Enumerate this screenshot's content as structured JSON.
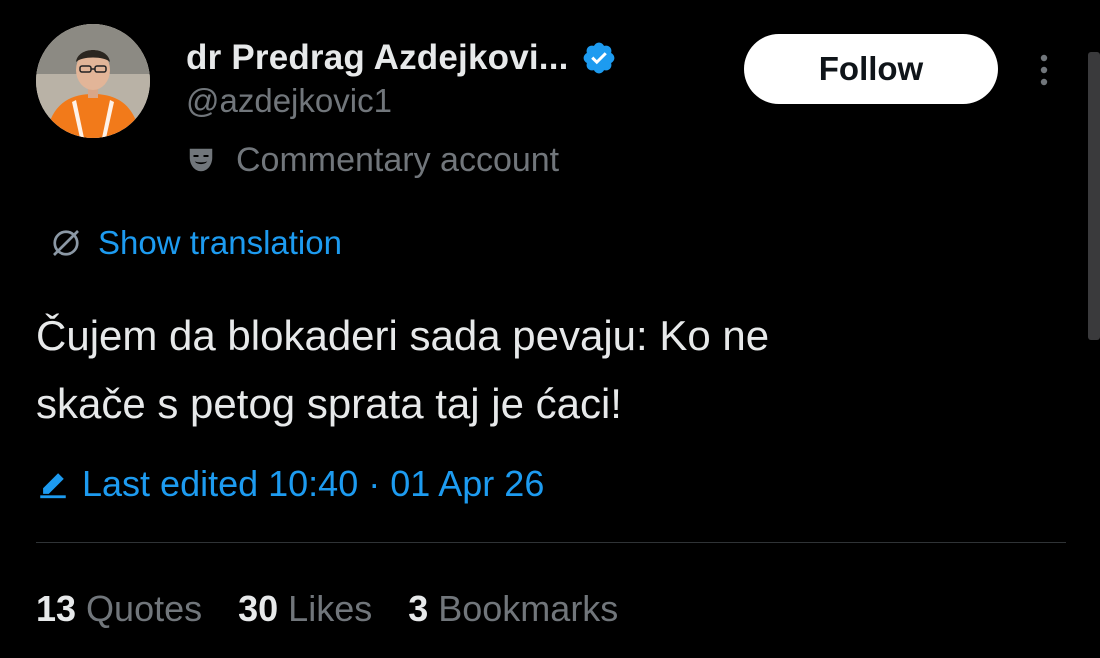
{
  "author": {
    "display_name": "dr Predrag Azdejkovi...",
    "handle": "@azdejkovic1",
    "label": "Commentary account",
    "verified_color": "#1d9bf0"
  },
  "actions": {
    "follow_label": "Follow"
  },
  "tweet": {
    "translate_label": "Show translation",
    "text": "Čujem da blokaderi sada pevaju: Ko ne\nskače s petog sprata taj je ćaci!",
    "edited_label": "Last edited 10:40 · 01 Apr 26"
  },
  "stats": [
    {
      "count": "13",
      "label": "Quotes"
    },
    {
      "count": "30",
      "label": "Likes"
    },
    {
      "count": "3",
      "label": "Bookmarks"
    }
  ],
  "icons": {
    "verified": "verified-badge-icon",
    "mask": "theater-mask-icon",
    "globe": "globe-icon",
    "pencil": "pencil-icon",
    "more": "more-vertical-icon"
  },
  "colors": {
    "background": "#000000",
    "text_primary": "#e7e9ea",
    "text_secondary": "#71767b",
    "accent": "#1d9bf0",
    "follow_bg": "#ffffff"
  }
}
